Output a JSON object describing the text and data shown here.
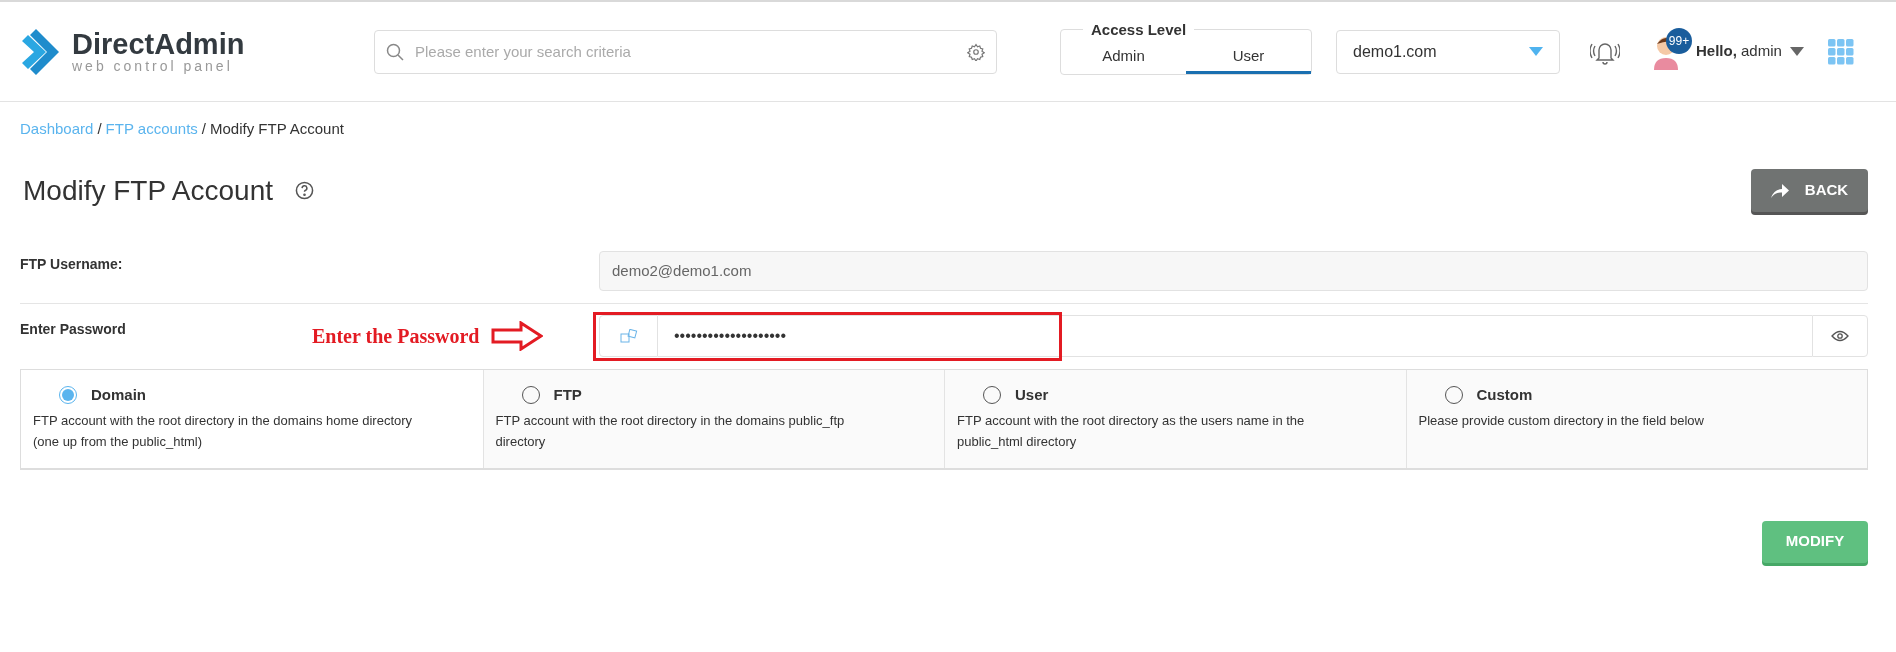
{
  "header": {
    "logo": {
      "name": "DirectAdmin",
      "tagline": "web control panel"
    },
    "search": {
      "placeholder": "Please enter your search criteria"
    },
    "access_level": {
      "title": "Access Level",
      "tabs": [
        {
          "label": "Admin",
          "selected": false
        },
        {
          "label": "User",
          "selected": true
        }
      ]
    },
    "domain_select": {
      "value": "demo1.com"
    },
    "notifications_badge": "99+",
    "greeting": {
      "prefix": "Hello,",
      "user": "admin"
    }
  },
  "breadcrumb": [
    {
      "label": "Dashboard",
      "kind": "link"
    },
    {
      "label": "/",
      "kind": "separator"
    },
    {
      "label": "FTP accounts",
      "kind": "link"
    },
    {
      "label": "/",
      "kind": "separator"
    },
    {
      "label": "Modify FTP Account",
      "kind": "current"
    }
  ],
  "page_title": "Modify FTP Account",
  "back_button": "BACK",
  "form": {
    "username": {
      "label": "FTP Username:",
      "value": "demo2@demo1.com",
      "disabled": true
    },
    "password": {
      "label": "Enter Password",
      "value": "••••••••••••••••••••"
    },
    "options": [
      {
        "label": "Domain",
        "description": "FTP account with the root directory in the domains home directory (one up from the public_html)",
        "selected": true
      },
      {
        "label": "FTP",
        "description": "FTP account with the root directory in the domains public_ftp directory",
        "selected": false
      },
      {
        "label": "User",
        "description": "FTP account with the root directory as the users name in the public_html directory",
        "selected": false
      },
      {
        "label": "Custom",
        "description": "Please provide custom directory in the field below",
        "selected": false
      }
    ]
  },
  "annotation": {
    "label": "Enter the Password"
  },
  "modify_button": "MODIFY"
}
